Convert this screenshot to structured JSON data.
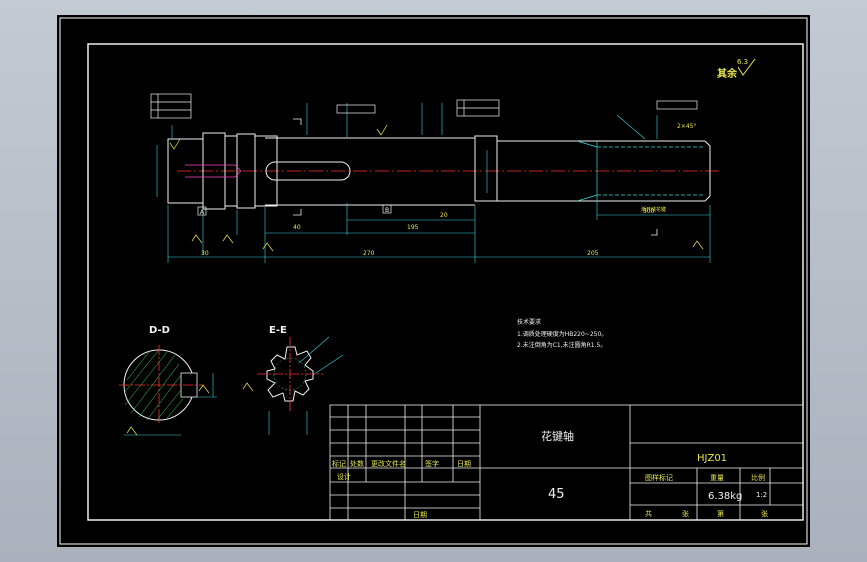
{
  "drawing": {
    "part_name": "花键轴",
    "material": "45",
    "drawing_no": "HJZ01",
    "mass": "6.38kg",
    "scale": "1:2",
    "surface_finish": {
      "label": "其余",
      "value": "6.3"
    },
    "section_labels": {
      "dd": "D-D",
      "ee": "E-E"
    },
    "notes": {
      "title": "技术要求",
      "line1": "1.调质处理硬度为HB220~250。",
      "line2": "2.未注倒角为C1,未注圆角R1.5。"
    },
    "title_block": {
      "mark": "标记",
      "count": "处数",
      "change_doc": "更改文件名",
      "signature": "签字",
      "date": "日期",
      "design": "设计",
      "date2": "日期",
      "stage_mark": "图样标记",
      "weight": "重量",
      "scale_h": "比例",
      "total": "共",
      "sheet_of": "张",
      "sheet_no": "第",
      "sheet_of2": "张"
    },
    "dims": {
      "d1": "30",
      "d2": "270",
      "d3": "205",
      "d4": "40",
      "d5": "195",
      "d6": "20",
      "d7": "300",
      "tag_a": "A",
      "tag_b": "B",
      "spline_len": "渐开线花键",
      "chamfer": "2×45°"
    }
  }
}
